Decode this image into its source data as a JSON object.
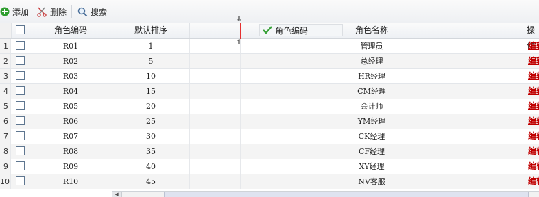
{
  "toolbar": {
    "add_label": "添加",
    "delete_label": "删除",
    "search_label": "搜索"
  },
  "header": {
    "role_code": "角色编码",
    "sort_order": "默认排序",
    "role_name": "角色名称",
    "actions": "操作"
  },
  "drag_proxy": {
    "label": "角色编码"
  },
  "rows": [
    {
      "num": "1",
      "code": "R01",
      "order": "1",
      "name": "管理员",
      "action": "编辑"
    },
    {
      "num": "2",
      "code": "R02",
      "order": "5",
      "name": "总经理",
      "action": "编辑"
    },
    {
      "num": "3",
      "code": "R03",
      "order": "10",
      "name": "HR经理",
      "action": "编辑"
    },
    {
      "num": "4",
      "code": "R04",
      "order": "15",
      "name": "CM经理",
      "action": "编辑"
    },
    {
      "num": "5",
      "code": "R05",
      "order": "20",
      "name": "会计师",
      "action": "编辑"
    },
    {
      "num": "6",
      "code": "R06",
      "order": "25",
      "name": "YM经理",
      "action": "编辑"
    },
    {
      "num": "7",
      "code": "R07",
      "order": "30",
      "name": "CK经理",
      "action": "编辑"
    },
    {
      "num": "8",
      "code": "R08",
      "order": "35",
      "name": "CF经理",
      "action": "编辑"
    },
    {
      "num": "9",
      "code": "R09",
      "order": "40",
      "name": "XY经理",
      "action": "编辑"
    },
    {
      "num": "10",
      "code": "R10",
      "order": "45",
      "name": "NV客服",
      "action": "编辑"
    }
  ],
  "colors": {
    "link": "#c00000",
    "drag_indicator": "#e53030",
    "add_icon": "#2f9e2f"
  }
}
